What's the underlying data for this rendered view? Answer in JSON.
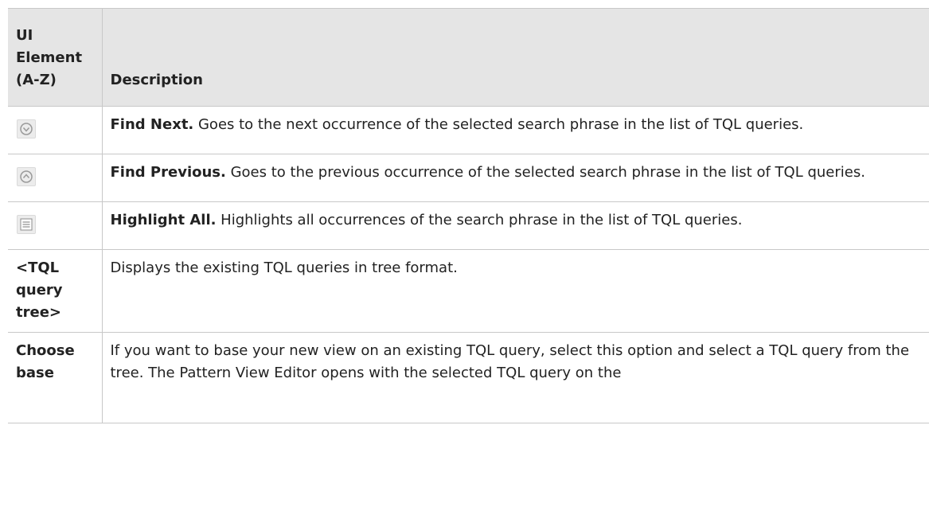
{
  "table": {
    "header": {
      "col1": "UI Element (A-Z)",
      "col2": "Description"
    },
    "rows": [
      {
        "icon": "find-next-icon",
        "term": "Find Next.",
        "text": " Goes to the next occurrence of the selected search phrase in the list of TQL queries."
      },
      {
        "icon": "find-previous-icon",
        "term": "Find Previous.",
        "text": " Goes to the previous occurrence of the selected search phrase in the list of TQL queries."
      },
      {
        "icon": "highlight-all-icon",
        "term": "Highlight All.",
        "text": " Highlights all occurrences of the search phrase in the list of TQL queries."
      },
      {
        "element": "<TQL query tree>",
        "text": "Displays the existing TQL queries in tree format."
      },
      {
        "element": "Choose base",
        "text": "If you want to base your new view on an existing TQL query, select this option and select a TQL query from the tree. The Pattern View Editor opens with the selected TQL query on the"
      }
    ]
  }
}
